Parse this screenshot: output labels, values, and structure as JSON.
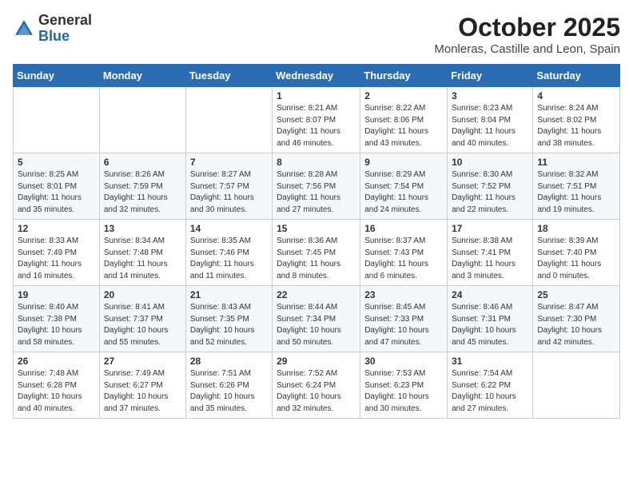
{
  "header": {
    "logo_general": "General",
    "logo_blue": "Blue",
    "month_title": "October 2025",
    "subtitle": "Monleras, Castille and Leon, Spain"
  },
  "weekdays": [
    "Sunday",
    "Monday",
    "Tuesday",
    "Wednesday",
    "Thursday",
    "Friday",
    "Saturday"
  ],
  "weeks": [
    [
      {
        "day": "",
        "info": ""
      },
      {
        "day": "",
        "info": ""
      },
      {
        "day": "",
        "info": ""
      },
      {
        "day": "1",
        "info": "Sunrise: 8:21 AM\nSunset: 8:07 PM\nDaylight: 11 hours\nand 46 minutes."
      },
      {
        "day": "2",
        "info": "Sunrise: 8:22 AM\nSunset: 8:06 PM\nDaylight: 11 hours\nand 43 minutes."
      },
      {
        "day": "3",
        "info": "Sunrise: 8:23 AM\nSunset: 8:04 PM\nDaylight: 11 hours\nand 40 minutes."
      },
      {
        "day": "4",
        "info": "Sunrise: 8:24 AM\nSunset: 8:02 PM\nDaylight: 11 hours\nand 38 minutes."
      }
    ],
    [
      {
        "day": "5",
        "info": "Sunrise: 8:25 AM\nSunset: 8:01 PM\nDaylight: 11 hours\nand 35 minutes."
      },
      {
        "day": "6",
        "info": "Sunrise: 8:26 AM\nSunset: 7:59 PM\nDaylight: 11 hours\nand 32 minutes."
      },
      {
        "day": "7",
        "info": "Sunrise: 8:27 AM\nSunset: 7:57 PM\nDaylight: 11 hours\nand 30 minutes."
      },
      {
        "day": "8",
        "info": "Sunrise: 8:28 AM\nSunset: 7:56 PM\nDaylight: 11 hours\nand 27 minutes."
      },
      {
        "day": "9",
        "info": "Sunrise: 8:29 AM\nSunset: 7:54 PM\nDaylight: 11 hours\nand 24 minutes."
      },
      {
        "day": "10",
        "info": "Sunrise: 8:30 AM\nSunset: 7:52 PM\nDaylight: 11 hours\nand 22 minutes."
      },
      {
        "day": "11",
        "info": "Sunrise: 8:32 AM\nSunset: 7:51 PM\nDaylight: 11 hours\nand 19 minutes."
      }
    ],
    [
      {
        "day": "12",
        "info": "Sunrise: 8:33 AM\nSunset: 7:49 PM\nDaylight: 11 hours\nand 16 minutes."
      },
      {
        "day": "13",
        "info": "Sunrise: 8:34 AM\nSunset: 7:48 PM\nDaylight: 11 hours\nand 14 minutes."
      },
      {
        "day": "14",
        "info": "Sunrise: 8:35 AM\nSunset: 7:46 PM\nDaylight: 11 hours\nand 11 minutes."
      },
      {
        "day": "15",
        "info": "Sunrise: 8:36 AM\nSunset: 7:45 PM\nDaylight: 11 hours\nand 8 minutes."
      },
      {
        "day": "16",
        "info": "Sunrise: 8:37 AM\nSunset: 7:43 PM\nDaylight: 11 hours\nand 6 minutes."
      },
      {
        "day": "17",
        "info": "Sunrise: 8:38 AM\nSunset: 7:41 PM\nDaylight: 11 hours\nand 3 minutes."
      },
      {
        "day": "18",
        "info": "Sunrise: 8:39 AM\nSunset: 7:40 PM\nDaylight: 11 hours\nand 0 minutes."
      }
    ],
    [
      {
        "day": "19",
        "info": "Sunrise: 8:40 AM\nSunset: 7:38 PM\nDaylight: 10 hours\nand 58 minutes."
      },
      {
        "day": "20",
        "info": "Sunrise: 8:41 AM\nSunset: 7:37 PM\nDaylight: 10 hours\nand 55 minutes."
      },
      {
        "day": "21",
        "info": "Sunrise: 8:43 AM\nSunset: 7:35 PM\nDaylight: 10 hours\nand 52 minutes."
      },
      {
        "day": "22",
        "info": "Sunrise: 8:44 AM\nSunset: 7:34 PM\nDaylight: 10 hours\nand 50 minutes."
      },
      {
        "day": "23",
        "info": "Sunrise: 8:45 AM\nSunset: 7:33 PM\nDaylight: 10 hours\nand 47 minutes."
      },
      {
        "day": "24",
        "info": "Sunrise: 8:46 AM\nSunset: 7:31 PM\nDaylight: 10 hours\nand 45 minutes."
      },
      {
        "day": "25",
        "info": "Sunrise: 8:47 AM\nSunset: 7:30 PM\nDaylight: 10 hours\nand 42 minutes."
      }
    ],
    [
      {
        "day": "26",
        "info": "Sunrise: 7:48 AM\nSunset: 6:28 PM\nDaylight: 10 hours\nand 40 minutes."
      },
      {
        "day": "27",
        "info": "Sunrise: 7:49 AM\nSunset: 6:27 PM\nDaylight: 10 hours\nand 37 minutes."
      },
      {
        "day": "28",
        "info": "Sunrise: 7:51 AM\nSunset: 6:26 PM\nDaylight: 10 hours\nand 35 minutes."
      },
      {
        "day": "29",
        "info": "Sunrise: 7:52 AM\nSunset: 6:24 PM\nDaylight: 10 hours\nand 32 minutes."
      },
      {
        "day": "30",
        "info": "Sunrise: 7:53 AM\nSunset: 6:23 PM\nDaylight: 10 hours\nand 30 minutes."
      },
      {
        "day": "31",
        "info": "Sunrise: 7:54 AM\nSunset: 6:22 PM\nDaylight: 10 hours\nand 27 minutes."
      },
      {
        "day": "",
        "info": ""
      }
    ]
  ]
}
